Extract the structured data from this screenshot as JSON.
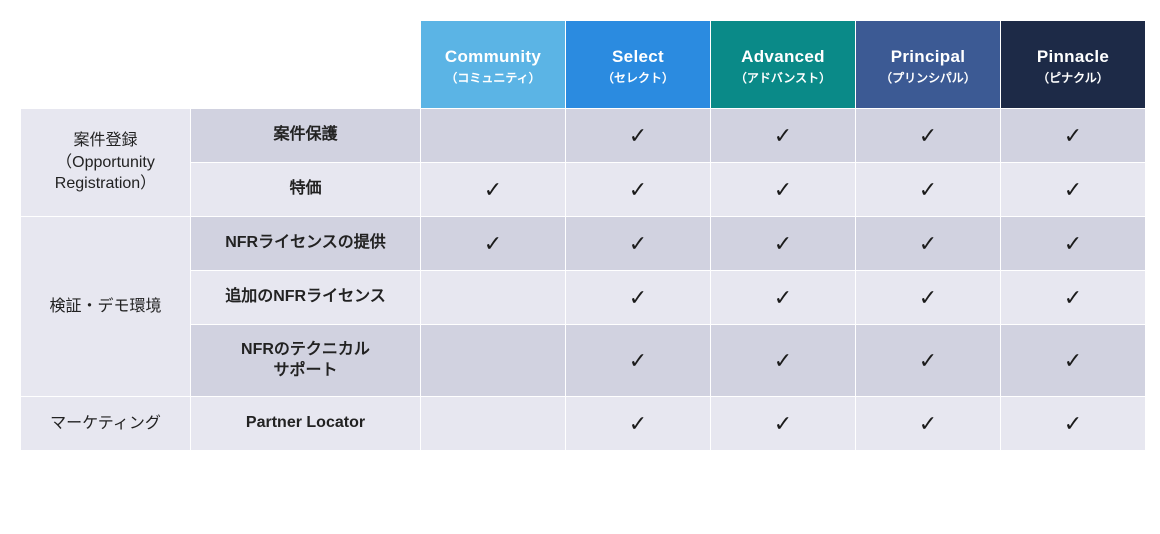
{
  "tiers": [
    {
      "id": "community",
      "title": "Community",
      "sub": "（コミュニティ）"
    },
    {
      "id": "select",
      "title": "Select",
      "sub": "（セレクト）"
    },
    {
      "id": "advanced",
      "title": "Advanced",
      "sub": "（アドバンスト）"
    },
    {
      "id": "principal",
      "title": "Principal",
      "sub": "（プリンシパル）"
    },
    {
      "id": "pinnacle",
      "title": "Pinnacle",
      "sub": "（ピナクル）"
    }
  ],
  "categories": [
    {
      "label": "案件登録（Opportunity Registration）",
      "rows": [
        {
          "label": "案件保護",
          "marks": [
            false,
            true,
            true,
            true,
            true
          ]
        },
        {
          "label": "特価",
          "marks": [
            true,
            true,
            true,
            true,
            true
          ]
        }
      ]
    },
    {
      "label": "検証・デモ環境",
      "rows": [
        {
          "label": "NFRライセンスの提供",
          "marks": [
            true,
            true,
            true,
            true,
            true
          ]
        },
        {
          "label": "追加のNFRライセンス",
          "marks": [
            false,
            true,
            true,
            true,
            true
          ]
        },
        {
          "label": "NFRのテクニカル\nサポート",
          "marks": [
            false,
            true,
            true,
            true,
            true
          ],
          "tall": true
        }
      ]
    },
    {
      "label": "マーケティング",
      "rows": [
        {
          "label": "Partner Locator",
          "marks": [
            false,
            true,
            true,
            true,
            true
          ]
        }
      ]
    }
  ],
  "checkmark": "✓"
}
